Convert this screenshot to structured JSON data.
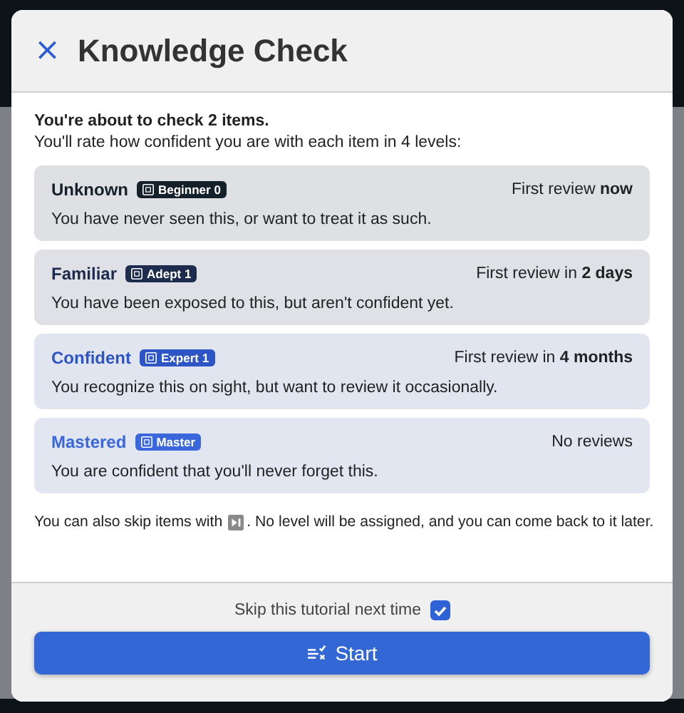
{
  "dialog": {
    "title": "Knowledge Check",
    "close": "×"
  },
  "intro": {
    "heading": "You're about to check 2 items.",
    "text": "You'll rate how confident you are with each item in 4 levels:"
  },
  "levels": [
    {
      "name": "Unknown",
      "badge": "Beginner 0",
      "color": "#14212b",
      "review": "First review **now**",
      "description": "You have never seen this, or want to treat it as such."
    },
    {
      "name": "Familiar",
      "badge": "Adept 1",
      "color": "#1d2b4d",
      "review": "First review in **2 days**",
      "description": "You have been exposed to this, but aren't confident yet."
    },
    {
      "name": "Confident",
      "badge": "Expert 1",
      "color": "#2d55c6",
      "review": "First review in **4 months**",
      "description": "You recognize this on sight, but want to review it occasionally."
    },
    {
      "name": "Mastered",
      "badge": "Master",
      "color": "#3a68dc",
      "review": "No reviews",
      "description": "You are confident that you'll never forget this."
    }
  ],
  "skip_note": {
    "before": "You can also skip items with",
    "after": ". No level will be assigned, and you can come back to it later."
  },
  "footer": {
    "checkbox": {
      "label": "Skip this tutorial next time",
      "checked": true
    },
    "button": "Start"
  }
}
